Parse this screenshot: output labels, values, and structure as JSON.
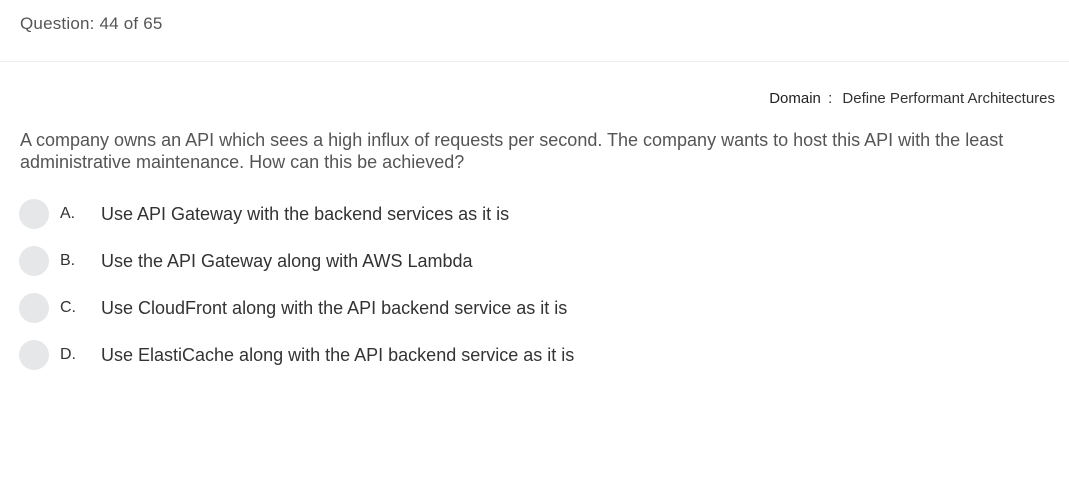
{
  "header": {
    "question_counter": "Question: 44 of 65"
  },
  "domain": {
    "label": "Domain",
    "separator": ":",
    "value": "Define Performant Architectures"
  },
  "question": {
    "text": "A company owns an API which sees a high influx of requests per second. The company wants to host this API with the least administrative maintenance. How can this be achieved?"
  },
  "options": [
    {
      "letter": "A.",
      "text": "Use API Gateway with the backend services as it is"
    },
    {
      "letter": "B.",
      "text": "Use the API Gateway along with AWS Lambda"
    },
    {
      "letter": "C.",
      "text": "Use CloudFront along with the API backend service as it is"
    },
    {
      "letter": "D.",
      "text": "Use ElastiCache along with the API backend service as it is"
    }
  ],
  "colors": {
    "radio_fill": "#e6e7e9",
    "text": "#333333"
  }
}
